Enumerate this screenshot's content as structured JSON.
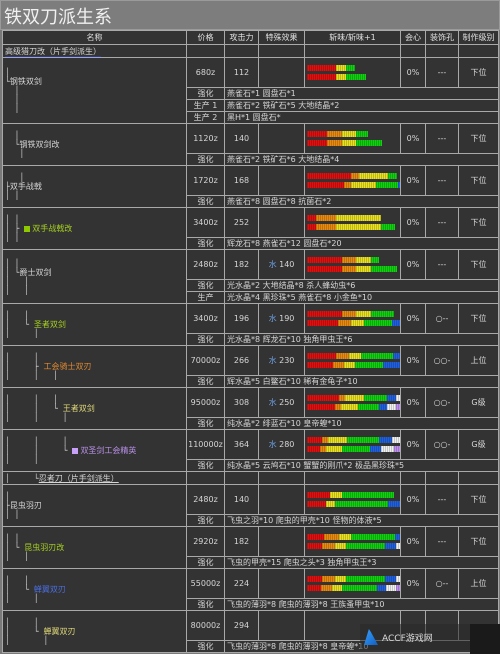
{
  "page_title": "铁双刀派生系",
  "columns": [
    "名称",
    "价格",
    "攻击力",
    "特殊效果",
    "斩味/斩味+1",
    "会心",
    "装饰孔",
    "制作级别"
  ],
  "type_labels": {
    "q": "强化",
    "p": "生产",
    "p1": "生产 1",
    "p2": "生产 2"
  },
  "colors": {
    "upgrade": "#e07a2c",
    "produce": "#3ccd3c",
    "water": "#6f9fe0"
  },
  "sections": [
    {
      "header": "高级猎刀改（片手剑派生）",
      "weapons": [
        {
          "tree": " │\n└钢铁双剑",
          "name": "钢铁双剑",
          "color": "#d6d6d6",
          "price": "680z",
          "attack": "112",
          "special": "",
          "affinity": "0%",
          "slots": "---",
          "rank": "下位",
          "sharpness": [
            [
              [
                "red",
                0.36
              ],
              [
                "org",
                0
              ],
              [
                "yel",
                0.15
              ],
              [
                "grn",
                0.1
              ]
            ],
            [
              [
                "red",
                0.36
              ],
              [
                "org",
                0
              ],
              [
                "yel",
                0.15
              ],
              [
                "grn",
                0.28
              ]
            ]
          ],
          "materials": [
            {
              "type": "q",
              "tree": "  │",
              "text": "燕雀石*1 圆盘石*1"
            },
            {
              "type": "p1",
              "tree": "  │",
              "text": "燕雀石*2 铁矿石*5 大地结晶*2"
            },
            {
              "type": "p2",
              "tree": "  │",
              "text": "黑H*1 圆盘石*"
            }
          ]
        },
        {
          "tree": "  │\n  └钢铁双剑改",
          "name": "钢铁双剑改",
          "color": "#d6d6d6",
          "price": "1120z",
          "attack": "140",
          "special": "",
          "affinity": "0%",
          "slots": "---",
          "rank": "下位",
          "sharpness": [
            [
              [
                "red",
                0.36
              ],
              [
                "org",
                0.2
              ],
              [
                "yel",
                0.2
              ],
              [
                "grn",
                0.18
              ]
            ],
            [
              [
                "red",
                0.36
              ],
              [
                "org",
                0.2
              ],
              [
                "yel",
                0.2
              ],
              [
                "grn",
                0.36
              ]
            ]
          ],
          "materials": [
            {
              "type": "q",
              "tree": "   │",
              "text": "燕雀石*2 铁矿石*6 大地结晶*4"
            }
          ]
        }
      ]
    }
  ],
  "rows": [
    {
      "kind": "weapon",
      "tree": "   │\n├双手战戟",
      "name": "双手战戟",
      "color": "#d6d6d6",
      "price": "1720z",
      "attack": "168",
      "special": "",
      "affinity": "0%",
      "slots": "---",
      "rank": "下位",
      "sharpness": [
        [
          [
            "red",
            0.36
          ],
          [
            "org",
            0.15
          ],
          [
            "yel",
            0.3
          ],
          [
            "grn",
            0.15
          ]
        ],
        [
          [
            "red",
            0.36
          ],
          [
            "org",
            0.15
          ],
          [
            "yel",
            0.3
          ],
          [
            "grn",
            0.18
          ],
          [
            "blu",
            0.04
          ]
        ]
      ],
      "materials": [
        {
          "type": "q",
          "tree": "│ │",
          "text": "燕雀石*8 圆盘石*8 抗菌石*2"
        }
      ]
    }
  ],
  "table": [
    {
      "kind": "header",
      "text": "高级猎刀改（片手剑派生）"
    },
    {
      "kind": "weapon",
      "tree": "│\n└钢铁双剑",
      "name": "钢铁双剑",
      "color": "#d6d6d6",
      "square": null,
      "price": "680z",
      "attack": "112",
      "special": "",
      "affinity": "0%",
      "slots": "---",
      "rank": "下位",
      "sharpness": [
        [
          [
            "red",
            20
          ],
          [
            "yel",
            7
          ],
          [
            "grn",
            6
          ]
        ],
        [
          [
            "red",
            20
          ],
          [
            "yel",
            7
          ],
          [
            "grn",
            14
          ]
        ]
      ],
      "materials": [
        {
          "type": "q",
          "tree": "  │",
          "text": "燕雀石*1 圆盘石*1"
        },
        {
          "type": "p1",
          "tree": "  │",
          "text": "燕雀石*2 铁矿石*5 大地结晶*2"
        },
        {
          "type": "p2",
          "tree": "  │",
          "text": "黑H*1 圆盘石*"
        }
      ]
    },
    {
      "kind": "weapon",
      "tree": "  │\n  └钢铁双剑改",
      "name": "钢铁双剑改",
      "color": "#d6d6d6",
      "square": null,
      "price": "1120z",
      "attack": "140",
      "special": "",
      "affinity": "0%",
      "slots": "---",
      "rank": "下位",
      "sharpness": [
        [
          [
            "red",
            14
          ],
          [
            "org",
            10
          ],
          [
            "yel",
            10
          ],
          [
            "grn",
            8
          ]
        ],
        [
          [
            "red",
            14
          ],
          [
            "org",
            10
          ],
          [
            "yel",
            10
          ],
          [
            "grn",
            18
          ]
        ]
      ],
      "materials": [
        {
          "type": "q",
          "tree": "   │",
          "text": "燕雀石*2 铁矿石*6 大地结晶*4"
        }
      ]
    },
    {
      "kind": "weapon",
      "tree": "   │\n├双手战戟",
      "name": "双手战戟",
      "color": "#d6d6d6",
      "square": null,
      "price": "1720z",
      "attack": "168",
      "special": "",
      "affinity": "0%",
      "slots": "---",
      "rank": "下位",
      "sharpness": [
        [
          [
            "red",
            30
          ],
          [
            "org",
            6
          ],
          [
            "yel",
            20
          ],
          [
            "grn",
            6
          ]
        ],
        [
          [
            "red",
            30
          ],
          [
            "org",
            6
          ],
          [
            "yel",
            20
          ],
          [
            "grn",
            18
          ],
          [
            "blu",
            2
          ]
        ]
      ],
      "materials": [
        {
          "type": "q",
          "tree": "│ │",
          "text": "燕雀石*8 圆盘石*8 抗菌石*2"
        }
      ]
    },
    {
      "kind": "weapon",
      "tree": "│ │\n│ ├ ■双手战戟改",
      "name": "双手战戟改",
      "color": "#a6d020",
      "square": "#8fc800",
      "price": "3400z",
      "attack": "252",
      "special": "",
      "affinity": "0%",
      "slots": "---",
      "rank": "下位",
      "sharpness": [
        [
          [
            "red",
            6
          ],
          [
            "org",
            14
          ],
          [
            "yel",
            31
          ]
        ],
        [
          [
            "red",
            6
          ],
          [
            "org",
            14
          ],
          [
            "yel",
            31
          ],
          [
            "grn",
            10
          ]
        ]
      ],
      "materials": [
        {
          "type": "q",
          "tree": "│ │",
          "text": "辉龙石*8 燕雀石*12 圆盘石*20"
        }
      ]
    },
    {
      "kind": "weapon",
      "tree": "│ │\n│ └爵士双剑",
      "name": "爵士双剑",
      "color": "#d6d6d6",
      "square": null,
      "price": "2480z",
      "attack": "182",
      "special_el": "水",
      "special_val": "140",
      "affinity": "0%",
      "slots": "---",
      "rank": "下位",
      "sharpness": [
        [
          [
            "red",
            24
          ],
          [
            "org",
            10
          ],
          [
            "yel",
            10
          ],
          [
            "grn",
            6
          ]
        ],
        [
          [
            "red",
            24
          ],
          [
            "org",
            10
          ],
          [
            "yel",
            10
          ],
          [
            "grn",
            18
          ]
        ]
      ],
      "materials": [
        {
          "type": "q",
          "tree": "│   │",
          "text": "光水晶*2 大地结晶*8 杀人蜂幼虫*6"
        },
        {
          "type": "p",
          "tree": "│   │",
          "text": "光水晶*4 黑珍珠*5 燕雀石*8 小金鱼*10"
        }
      ]
    },
    {
      "kind": "weapon",
      "tree": "│   │\n│   └ 圣者双剑",
      "name": "圣者双剑",
      "color": "#a6d020",
      "square": null,
      "price": "3400z",
      "attack": "196",
      "special_el": "水",
      "special_val": "190",
      "affinity": "0%",
      "slots": "○--",
      "rank": "下位",
      "sharpness": [
        [
          [
            "red",
            24
          ],
          [
            "org",
            10
          ],
          [
            "yel",
            10
          ],
          [
            "grn",
            16
          ]
        ],
        [
          [
            "red",
            24
          ],
          [
            "org",
            10
          ],
          [
            "yel",
            10
          ],
          [
            "grn",
            22
          ],
          [
            "blu",
            6
          ]
        ]
      ],
      "materials": [
        {
          "type": "q",
          "tree": "│     │",
          "text": "光水晶*8 辉龙石*10 独角甲虫王*6"
        }
      ]
    },
    {
      "kind": "weapon",
      "tree": "│     │\n│     ├ 工会骑士双刃",
      "name": "工会骑士双刃",
      "color": "#e08a30",
      "square": null,
      "price": "70000z",
      "attack": "266",
      "special_el": "水",
      "special_val": "230",
      "affinity": "0%",
      "slots": "○○-",
      "rank": "上位",
      "sharpness": [
        [
          [
            "red",
            24
          ],
          [
            "org",
            10
          ],
          [
            "yel",
            10
          ],
          [
            "grn",
            26
          ],
          [
            "blu",
            6
          ]
        ],
        [
          [
            "red",
            24
          ],
          [
            "org",
            10
          ],
          [
            "yel",
            10
          ],
          [
            "grn",
            26
          ],
          [
            "blu",
            16
          ]
        ]
      ],
      "materials": [
        {
          "type": "q",
          "tree": "│     │   │",
          "text": "辉水晶*5 白鳖石*10 稀有金龟子*10"
        }
      ]
    },
    {
      "kind": "weapon",
      "tree": "│     │   │\n│     │   └ 王者双剑",
      "name": "王者双剑",
      "color": "#e0d878",
      "square": null,
      "price": "95000z",
      "attack": "308",
      "special_el": "水",
      "special_val": "250",
      "affinity": "0%",
      "slots": "○○-",
      "rank": "G级",
      "sharpness": [
        [
          [
            "red",
            30
          ],
          [
            "org",
            6
          ],
          [
            "yel",
            18
          ],
          [
            "grn",
            22
          ],
          [
            "blu",
            8
          ],
          [
            "wht",
            4
          ]
        ],
        [
          [
            "red",
            30
          ],
          [
            "org",
            6
          ],
          [
            "yel",
            18
          ],
          [
            "grn",
            22
          ],
          [
            "blu",
            8
          ],
          [
            "wht",
            10
          ],
          [
            "pur",
            4
          ]
        ]
      ],
      "materials": [
        {
          "type": "q",
          "tree": "│     │     │",
          "text": "纯水晶*2 绯蓝石*10 皇帝蝗*10"
        }
      ]
    },
    {
      "kind": "weapon",
      "tree": "│     │     │\n│     │     └ ■双圣剑工会精英",
      "name": "双圣剑工会精英",
      "color": "#b890e8",
      "square": "#c8a0f8",
      "price": "110000z",
      "attack": "364",
      "special_el": "水",
      "special_val": "280",
      "affinity": "0%",
      "slots": "○○-",
      "rank": "G级",
      "sharpness": [
        [
          [
            "red",
            14
          ],
          [
            "org",
            6
          ],
          [
            "yel",
            18
          ],
          [
            "grn",
            30
          ],
          [
            "blu",
            12
          ],
          [
            "wht",
            8
          ]
        ],
        [
          [
            "red",
            14
          ],
          [
            "org",
            6
          ],
          [
            "yel",
            18
          ],
          [
            "grn",
            30
          ],
          [
            "blu",
            12
          ],
          [
            "wht",
            14
          ],
          [
            "pur",
            6
          ]
        ]
      ],
      "materials": [
        {
          "type": "q",
          "tree": "│     │",
          "text": "纯水晶*5 云鸠石*10 蟹蟹的刚爪*2 极品黑珍珠*5"
        }
      ]
    },
    {
      "kind": "subheader",
      "tree": "│     └",
      "text": "忍者刀（片手剑派生）"
    },
    {
      "kind": "weapon",
      "tree": "│\n├昆虫羽刃",
      "name": "昆虫羽刃",
      "color": "#d6d6d6",
      "square": null,
      "price": "2480z",
      "attack": "140",
      "special": "",
      "affinity": "0%",
      "slots": "---",
      "rank": "下位",
      "sharpness": [
        [
          [
            "red",
            16
          ],
          [
            "yel",
            8
          ],
          [
            "grn",
            36
          ]
        ],
        [
          [
            "red",
            16
          ],
          [
            "yel",
            8
          ],
          [
            "grn",
            46
          ],
          [
            "blu",
            10
          ]
        ]
      ],
      "materials": [
        {
          "type": "q",
          "tree": "│ │",
          "text": "飞虫之羽*10 爬虫的甲壳*10 怪物的体液*5"
        }
      ]
    },
    {
      "kind": "weapon",
      "tree": "│ │\n│ └ 昆虫羽刃改",
      "name": "昆虫羽刃改",
      "color": "#a6d020",
      "square": null,
      "price": "2920z",
      "attack": "182",
      "special": "",
      "affinity": "0%",
      "slots": "---",
      "rank": "下位",
      "sharpness": [
        [
          [
            "red",
            14
          ],
          [
            "org",
            12
          ],
          [
            "yel",
            10
          ],
          [
            "grn",
            36
          ],
          [
            "blu",
            4
          ]
        ],
        [
          [
            "red",
            14
          ],
          [
            "org",
            12
          ],
          [
            "yel",
            10
          ],
          [
            "grn",
            36
          ],
          [
            "blu",
            10
          ],
          [
            "wht",
            4
          ]
        ]
      ],
      "materials": [
        {
          "type": "q",
          "tree": "│   │",
          "text": "飞虫的甲壳*15 爬虫之头*3 独角甲虫王*3"
        }
      ]
    },
    {
      "kind": "weapon",
      "tree": "│   │\n│   └ 蝉翼双刃",
      "name": "蝉翼双刃",
      "color": "#4a6ee0",
      "square": null,
      "price": "55000z",
      "attack": "224",
      "special": "",
      "affinity": "0%",
      "slots": "○--",
      "rank": "上位",
      "sharpness": [
        [
          [
            "red",
            14
          ],
          [
            "org",
            12
          ],
          [
            "yel",
            10
          ],
          [
            "grn",
            36
          ],
          [
            "blu",
            10
          ],
          [
            "wht",
            4
          ]
        ],
        [
          [
            "red",
            14
          ],
          [
            "org",
            12
          ],
          [
            "yel",
            10
          ],
          [
            "grn",
            36
          ],
          [
            "blu",
            10
          ],
          [
            "wht",
            10
          ],
          [
            "pur",
            4
          ]
        ]
      ],
      "materials": [
        {
          "type": "q",
          "tree": "│     │",
          "text": "飞虫的薄羽*8 爬虫的薄羽*8 王族蚤甲虫*10"
        }
      ]
    },
    {
      "kind": "weapon",
      "tree": "│     │\n│     └ 蝉翼双刃",
      "name": "蝉翼双刃",
      "color": "#e0d878",
      "square": null,
      "price": "80000z",
      "attack": "294",
      "special": "",
      "affinity": "",
      "slots": "",
      "rank": "",
      "sharpness": [],
      "materials": [
        {
          "type": "q",
          "tree": "│       │",
          "text": "飞虫的薄羽*8 爬虫的薄羽*8 皇帝蝗*10"
        }
      ]
    }
  ],
  "watermark": "ACCF游戏网"
}
